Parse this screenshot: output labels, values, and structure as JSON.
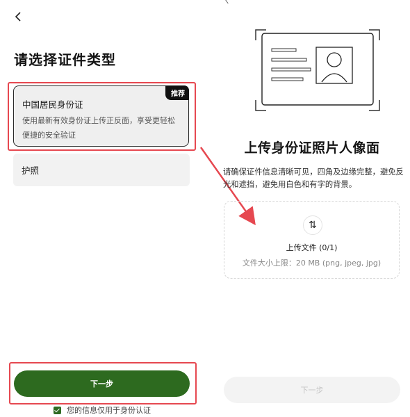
{
  "left": {
    "back_icon": "chevron-left-icon",
    "title": "请选择证件类型",
    "options": [
      {
        "title": "中国居民身份证",
        "desc": "使用最新有效身份证上传正反面，享受更轻松便捷的安全验证",
        "badge": "推荐",
        "selected": true
      },
      {
        "title": "护照",
        "selected": false
      }
    ],
    "next_label": "下一步",
    "privacy_text": "您的信息仅用于身份认证"
  },
  "right": {
    "title": "上传身份证照片人像面",
    "desc": "请确保证件信息清晰可见，四角及边缘完整，避免反光和遮挡，避免用白色和有字的背景。",
    "upload_icon": "swap-arrows-icon",
    "upload_count": "上传文件 (0/1)",
    "upload_limit": "文件大小上限：20 MB (png, jpeg, jpg)",
    "next_label": "下一步"
  },
  "colors": {
    "primary": "#2d6a1f",
    "annotation": "#e64850",
    "disabled_bg": "#f3f3f3"
  }
}
